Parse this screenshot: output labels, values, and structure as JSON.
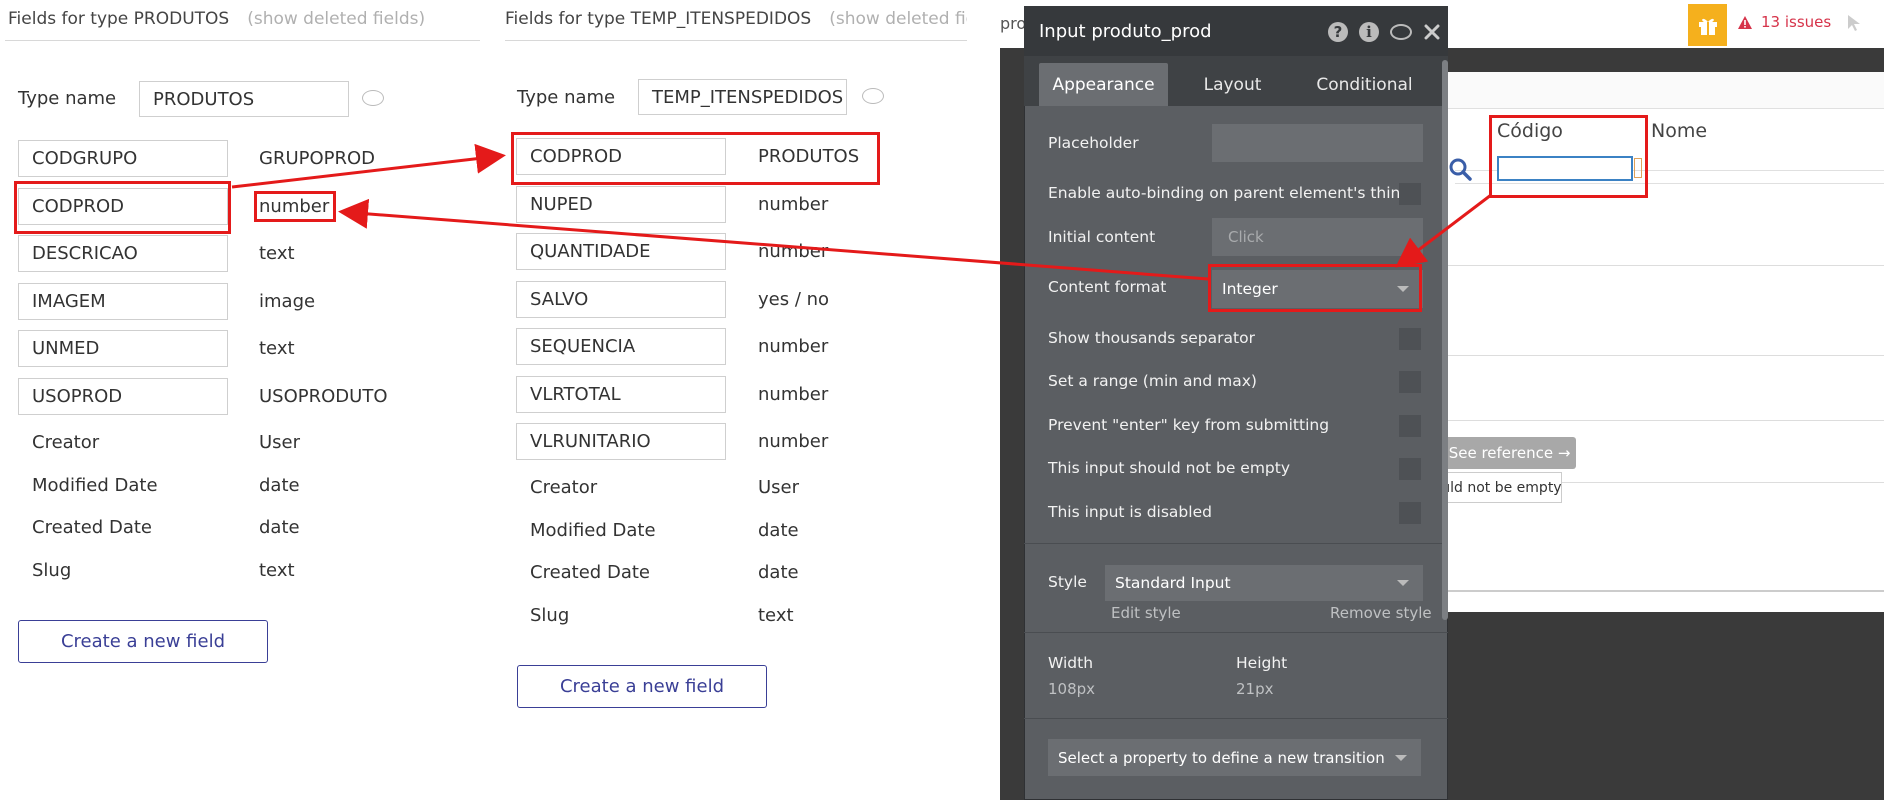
{
  "left_panel": {
    "title": "Fields for type PRODUTOS",
    "show_deleted": "(show deleted fields)",
    "type_name_label": "Type name",
    "type_name_value": "PRODUTOS",
    "fields": [
      {
        "name": "CODGRUPO",
        "type": "GRUPOPROD"
      },
      {
        "name": "CODPROD",
        "type": "number"
      },
      {
        "name": "DESCRICAO",
        "type": "text"
      },
      {
        "name": "IMAGEM",
        "type": "image"
      },
      {
        "name": "UNMED",
        "type": "text"
      },
      {
        "name": "USOPROD",
        "type": "USOPRODUTO"
      }
    ],
    "builtin": [
      {
        "name": "Creator",
        "type": "User"
      },
      {
        "name": "Modified Date",
        "type": "date"
      },
      {
        "name": "Created Date",
        "type": "date"
      },
      {
        "name": "Slug",
        "type": "text"
      }
    ],
    "create_button": "Create a new field"
  },
  "middle_panel": {
    "title": "Fields for type TEMP_ITENSPEDIDOS",
    "show_deleted": "(show deleted fields)",
    "type_name_label": "Type name",
    "type_name_value": "TEMP_ITENSPEDIDOS",
    "fields": [
      {
        "name": "CODPROD",
        "type": "PRODUTOS"
      },
      {
        "name": "NUPED",
        "type": "number"
      },
      {
        "name": "QUANTIDADE",
        "type": "number"
      },
      {
        "name": "SALVO",
        "type": "yes / no"
      },
      {
        "name": "SEQUENCIA",
        "type": "number"
      },
      {
        "name": "VLRTOTAL",
        "type": "number"
      },
      {
        "name": "VLRUNITARIO",
        "type": "number"
      }
    ],
    "builtin": [
      {
        "name": "Creator",
        "type": "User"
      },
      {
        "name": "Modified Date",
        "type": "date"
      },
      {
        "name": "Created Date",
        "type": "date"
      },
      {
        "name": "Slug",
        "type": "text"
      }
    ],
    "create_button": "Create a new field"
  },
  "app": {
    "top_left_fragment": "prod",
    "issues": "13 issues",
    "column_codigo": "Código",
    "column_nome": "Nome",
    "see_reference": "See reference →",
    "tooltip": "This input should not be empty"
  },
  "inspector": {
    "title": "Input produto_prod",
    "tabs": [
      "Appearance",
      "Layout",
      "Conditional"
    ],
    "placeholder_label": "Placeholder",
    "placeholder_value": "",
    "autobinding_label": "Enable auto-binding on parent element's thing",
    "initial_content_label": "Initial content",
    "initial_content_value": "Click",
    "content_format_label": "Content format",
    "content_format_value": "Integer",
    "thousands_label": "Show thousands separator",
    "range_label": "Set a range (min and max)",
    "prevent_enter_label": "Prevent \"enter\" key from submitting",
    "not_empty_label": "This input should not be empty",
    "disabled_label": "This input is disabled",
    "style_label": "Style",
    "style_value": "Standard Input",
    "edit_style": "Edit style",
    "remove_style": "Remove style",
    "width_label": "Width",
    "width_value": "108px",
    "height_label": "Height",
    "height_value": "21px",
    "transition_label": "Select a property to define a new transition"
  },
  "colors": {
    "annotation_red": "#e41a1a",
    "button_blue": "#3a3f96",
    "issues_red": "#d6334a",
    "gift_yellow": "#f5b01d"
  }
}
